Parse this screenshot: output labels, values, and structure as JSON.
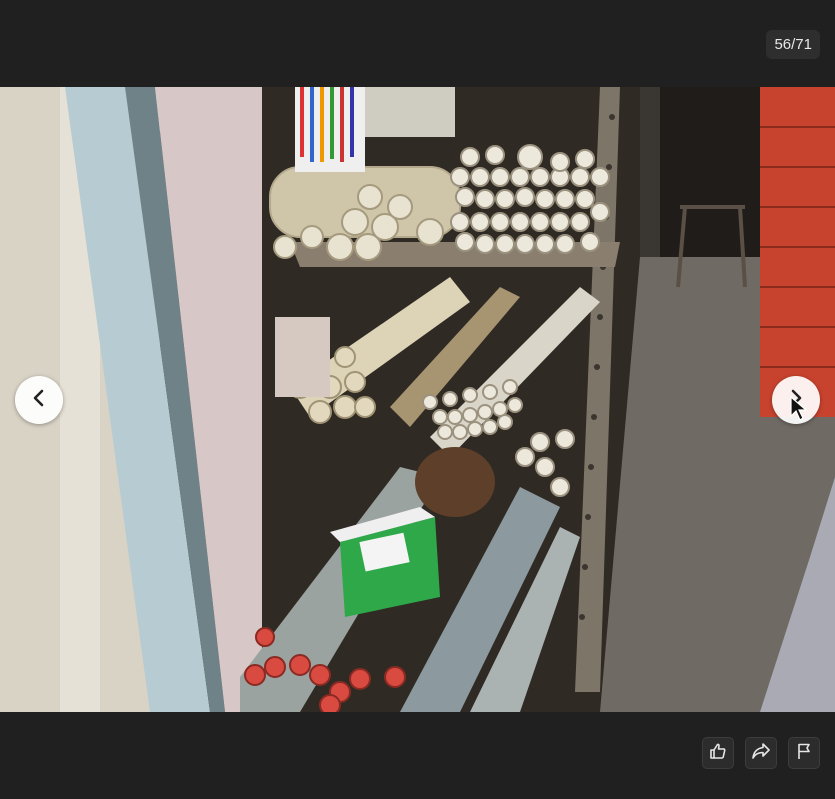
{
  "viewer": {
    "counter": "56/71",
    "current_index": 56,
    "total": 71,
    "image_description_icon": "photo-of-pipe-shelf"
  },
  "navigation": {
    "prev_icon": "chevron-left-icon",
    "next_icon": "chevron-right-icon"
  },
  "actions": [
    {
      "name": "like",
      "icon": "thumbs-up-icon"
    },
    {
      "name": "share",
      "icon": "share-arrow-icon"
    },
    {
      "name": "report",
      "icon": "flag-icon"
    }
  ],
  "colors": {
    "background": "#202020",
    "button_bg": "#2c2c2c",
    "counter_bg": "#2e2e2e",
    "nav_button_bg": "#ffffff"
  }
}
